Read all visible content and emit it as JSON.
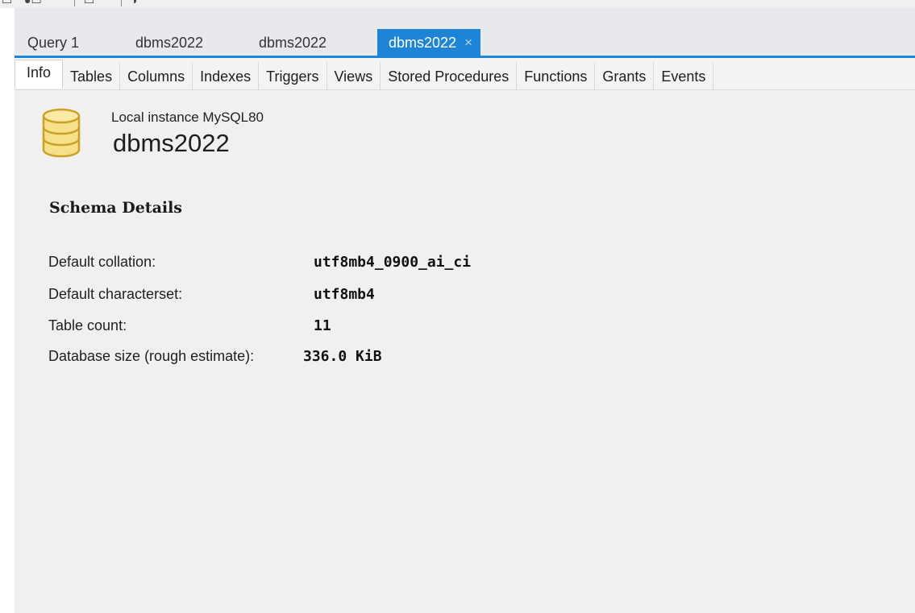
{
  "toolbar": {
    "icons": [
      "new-query-icon",
      "open-sql-icon",
      "inspector-icon"
    ]
  },
  "query_tabs": [
    {
      "label": "Query 1",
      "active": false
    },
    {
      "label": "dbms2022",
      "active": false
    },
    {
      "label": "dbms2022",
      "active": false
    },
    {
      "label": "dbms2022",
      "active": true,
      "close_glyph": "×"
    }
  ],
  "sub_tabs": [
    {
      "label": "Info",
      "active": true
    },
    {
      "label": "Tables"
    },
    {
      "label": "Columns"
    },
    {
      "label": "Indexes"
    },
    {
      "label": "Triggers"
    },
    {
      "label": "Views"
    },
    {
      "label": "Stored Procedures"
    },
    {
      "label": "Functions"
    },
    {
      "label": "Grants"
    },
    {
      "label": "Events"
    }
  ],
  "header": {
    "instance": "Local instance MySQL80",
    "schema_name": "dbms2022"
  },
  "schema_details": {
    "title": "Schema Details",
    "rows": [
      {
        "label": "Default collation:",
        "value": "utf8mb4_0900_ai_ci"
      },
      {
        "label": "Default characterset:",
        "value": "utf8mb4"
      },
      {
        "label": "Table count:",
        "value": "11"
      },
      {
        "label": "Database size (rough estimate):",
        "value": "336.0 KiB"
      }
    ]
  },
  "colors": {
    "accent": "#1d84d6",
    "db_icon_fill": "#f7e08a",
    "db_icon_stroke": "#c9a227"
  }
}
